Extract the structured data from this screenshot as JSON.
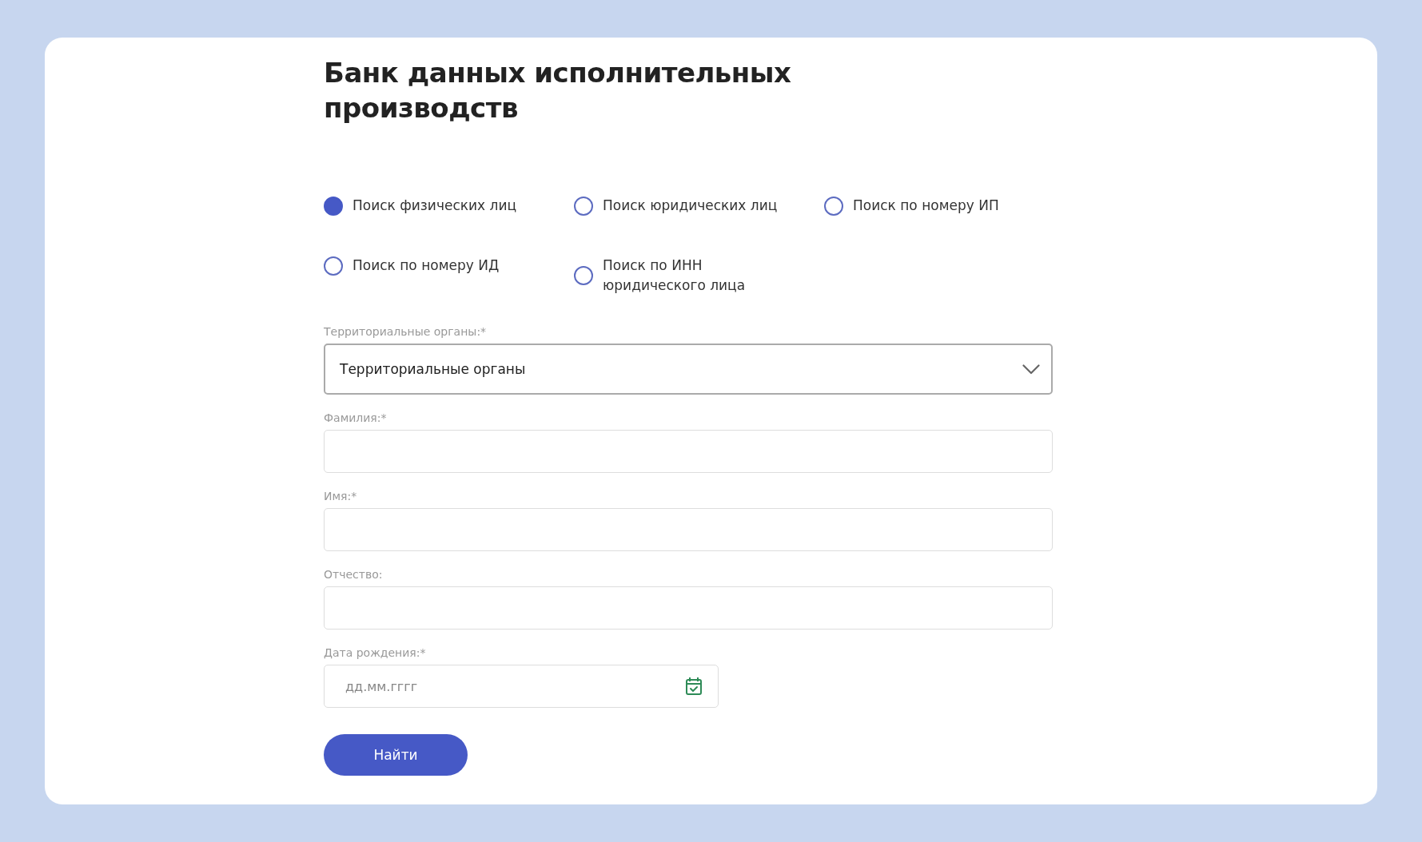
{
  "title": "Банк данных исполнительных производств",
  "search_types": [
    {
      "label": "Поиск физических лиц",
      "selected": true
    },
    {
      "label": "Поиск юридических лиц",
      "selected": false
    },
    {
      "label": "Поиск по номеру ИП",
      "selected": false
    },
    {
      "label": "Поиск по номеру ИД",
      "selected": false
    },
    {
      "label": "Поиск по ИНН юридического лица",
      "selected": false
    }
  ],
  "fields": [
    {
      "kind": "select",
      "label": "Территориальные органы:*",
      "value": "Территориальные органы"
    },
    {
      "kind": "text",
      "label": "Фамилия:*"
    },
    {
      "kind": "text",
      "label": "Имя:*"
    },
    {
      "kind": "text",
      "label": "Отчество:"
    },
    {
      "kind": "date",
      "label": "Дата рождения:*",
      "placeholder": "дд.мм.гггг"
    }
  ],
  "submit_button": "Найти"
}
